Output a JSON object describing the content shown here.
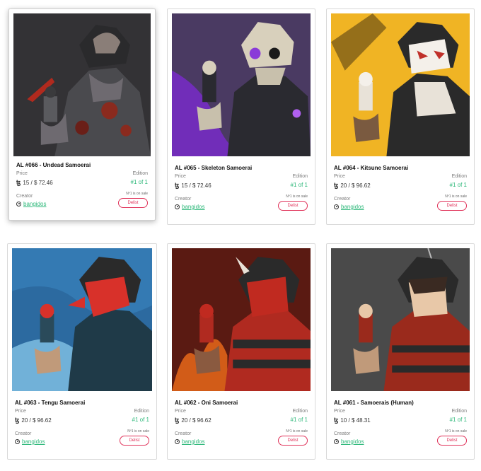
{
  "cards": [
    {
      "title": "AL #066 - Undead Samoerai",
      "price_label": "Price",
      "price": "15 / $ 72.46",
      "edition_label": "Edition",
      "edition": "#1 of 1",
      "on_sale": "Nº1 is on sale",
      "creator_label": "Creator",
      "creator": "bangidos",
      "delist_label": "Delist",
      "colors": {
        "bg": "#3b3a3d",
        "accent": "#8a2a1e",
        "armor": "#4a4a4e"
      }
    },
    {
      "title": "AL #065 - Skeleton Samoerai",
      "price_label": "Price",
      "price": "15 / $ 72.46",
      "edition_label": "Edition",
      "edition": "#1 of 1",
      "on_sale": "Nº1 is on sale",
      "creator_label": "Creator",
      "creator": "bangidos",
      "delist_label": "Delist",
      "colors": {
        "bg": "#4a3a62",
        "accent": "#8a3ad8",
        "armor": "#2a2a30"
      }
    },
    {
      "title": "AL #064 - Kitsune Samoerai",
      "price_label": "Price",
      "price": "20 / $ 96.62",
      "edition_label": "Edition",
      "edition": "#1 of 1",
      "on_sale": "Nº1 is on sale",
      "creator_label": "Creator",
      "creator": "bangidos",
      "delist_label": "Delist",
      "colors": {
        "bg": "#f0b424",
        "accent": "#d8d0c8",
        "armor": "#2a2a2a"
      }
    },
    {
      "title": "AL #063 - Tengu Samoerai",
      "price_label": "Price",
      "price": "20 / $ 96.62",
      "edition_label": "Edition",
      "edition": "#1 of 1",
      "on_sale": "Nº1 is on sale",
      "creator_label": "Creator",
      "creator": "bangidos",
      "delist_label": "Delist",
      "colors": {
        "bg": "#2c6aa0",
        "accent": "#d8312a",
        "armor": "#1f3a48"
      }
    },
    {
      "title": "AL #062 - Oni Samoerai",
      "price_label": "Price",
      "price": "20 / $ 96.62",
      "edition_label": "Edition",
      "edition": "#1 of 1",
      "on_sale": "Nº1 is on sale",
      "creator_label": "Creator",
      "creator": "bangidos",
      "delist_label": "Delist",
      "colors": {
        "bg": "#5a1a12",
        "accent": "#e8681a",
        "armor": "#b02a20"
      }
    },
    {
      "title": "AL #061 - Samoerais (Human)",
      "price_label": "Price",
      "price": "10 / $ 48.31",
      "edition_label": "Edition",
      "edition": "#1 of 1",
      "on_sale": "Nº1 is on sale",
      "creator_label": "Creator",
      "creator": "bangidos",
      "delist_label": "Delist",
      "colors": {
        "bg": "#4a4a4a",
        "accent": "#c0321e",
        "armor": "#9a2a1c"
      }
    }
  ],
  "currency_icon": "tezos-icon"
}
